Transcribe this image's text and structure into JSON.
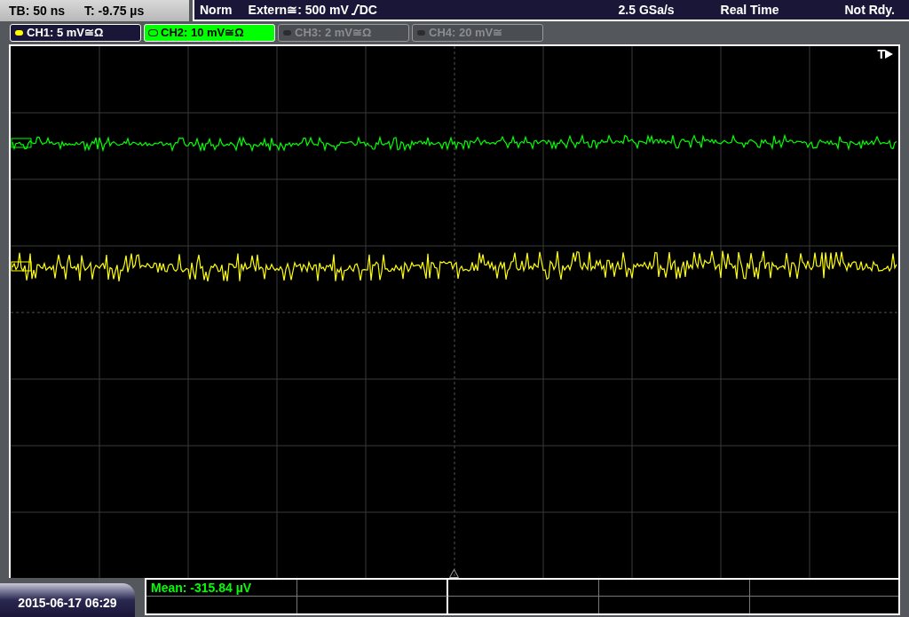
{
  "header": {
    "timebase": "TB: 50 ns",
    "trigger_time": "T: -9.75 µs",
    "trigger_mode": "Norm",
    "trigger_source": "Extern≅: 500 mV",
    "trigger_coupling": "DC",
    "sample_rate": "2.5 GSa/s",
    "acquisition_mode": "Real Time",
    "status": "Not Rdy."
  },
  "channels": [
    {
      "label": "CH1: 5 mV≅Ω",
      "on": true,
      "selected": false,
      "color": "#ffff00"
    },
    {
      "label": "CH2: 10 mV≅Ω",
      "on": true,
      "selected": true,
      "color": "#00ff00"
    },
    {
      "label": "CH3: 2 mV≅Ω",
      "on": false,
      "selected": false
    },
    {
      "label": "CH4: 20 mV≅",
      "on": false,
      "selected": false
    }
  ],
  "trigger_marker": "T",
  "measurement": "Mean: -315.84 µV",
  "date": "2015-06-17 06:29"
}
